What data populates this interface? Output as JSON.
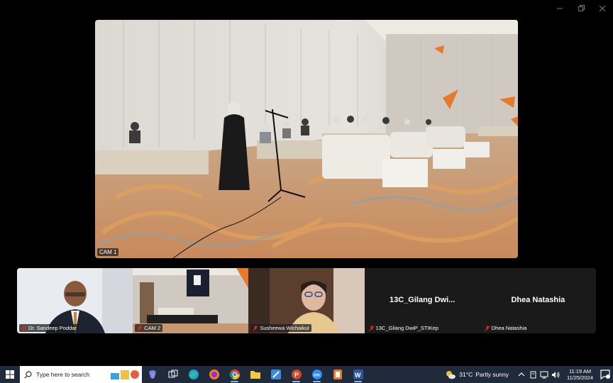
{
  "window": {
    "minimize_icon": "minimize-icon",
    "restore_icon": "restore-icon",
    "close_icon": "close-icon"
  },
  "main_video": {
    "label": "CAM 1"
  },
  "tiles": [
    {
      "label": "Dr. Sandeep Poddar",
      "type": "video"
    },
    {
      "label": "CAM 2",
      "type": "video"
    },
    {
      "label": "Susheewa Wichaikul",
      "type": "video"
    },
    {
      "label": "13C_Gilang DwiP_STIKep",
      "center_name": "13C_Gilang  Dwi...",
      "type": "name-only"
    },
    {
      "label": "Dhea Natashia",
      "center_name": "Dhea Natashia",
      "type": "name-only"
    }
  ],
  "taskbar": {
    "search_placeholder": "Type here to search",
    "apps": [
      "copilot-icon",
      "task-view-icon",
      "edge-icon",
      "firefox-icon",
      "chrome-icon",
      "file-explorer-icon",
      "paint-icon",
      "powerpoint-icon",
      "zoom-icon",
      "app-orange-icon",
      "word-icon"
    ],
    "weather": {
      "temp": "31°C",
      "desc": "Partly sunny"
    },
    "clock": {
      "time": "11:19 AM",
      "date": "11/25/2024"
    }
  },
  "colors": {
    "taskbar_bg": "#1f2a3a",
    "muted_mic": "#e02828",
    "tile_bg": "#1a1a1a"
  }
}
